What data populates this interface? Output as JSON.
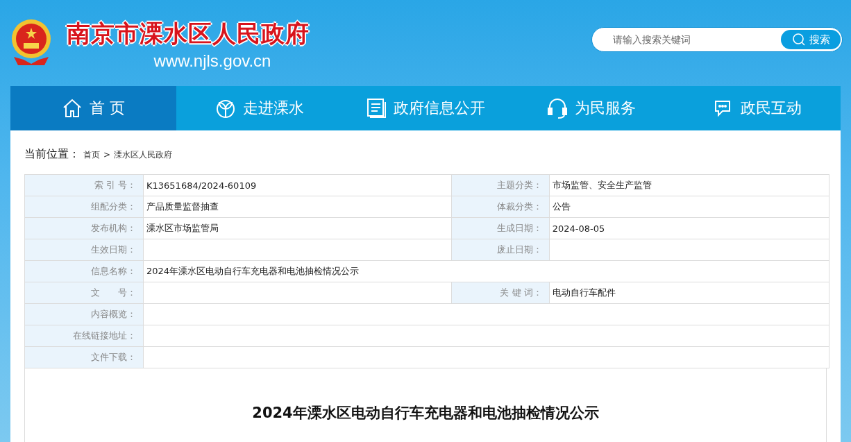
{
  "header": {
    "site_name": "南京市溧水区人民政府",
    "domain": "www.njls.gov.cn",
    "search": {
      "placeholder": "请输入搜索关键词",
      "button": "搜索"
    }
  },
  "nav": [
    {
      "label": "首 页",
      "selected": true
    },
    {
      "label": "走进溧水",
      "selected": false
    },
    {
      "label": "政府信息公开",
      "selected": false
    },
    {
      "label": "为民服务",
      "selected": false
    },
    {
      "label": "政民互动",
      "selected": false
    }
  ],
  "breadcrumb": {
    "label": "当前位置：",
    "items": [
      "首页",
      "溧水区人民政府"
    ],
    "separator": ">"
  },
  "info_table": [
    {
      "cells": [
        {
          "label": "索 引 号：",
          "value": "K13651684/2024-60109"
        },
        {
          "label": "主题分类：",
          "value": "市场监管、安全生产监管"
        }
      ]
    },
    {
      "cells": [
        {
          "label": "组配分类：",
          "value": "产品质量监督抽查"
        },
        {
          "label": "体裁分类：",
          "value": "公告"
        }
      ]
    },
    {
      "cells": [
        {
          "label": "发布机构：",
          "value": "溧水区市场监管局"
        },
        {
          "label": "生成日期：",
          "value": "2024-08-05"
        }
      ]
    },
    {
      "cells": [
        {
          "label": "生效日期："
        },
        {
          "label": "废止日期："
        }
      ]
    },
    {
      "cells": [
        {
          "label": "信息名称：",
          "value": "2024年溧水区电动自行车充电器和电池抽检情况公示"
        }
      ]
    },
    {
      "cells": [
        {
          "label": "文　　号："
        },
        {
          "label": "关 键 词：",
          "value": "电动自行车配件"
        }
      ]
    },
    {
      "cells": [
        {
          "label": "内容概览："
        }
      ]
    },
    {
      "cells": [
        {
          "label": "在线链接地址："
        }
      ]
    },
    {
      "cells": [
        {
          "label": "文件下载："
        }
      ]
    }
  ],
  "article": {
    "title": "2024年溧水区电动自行车充电器和电池抽检情况公示"
  }
}
